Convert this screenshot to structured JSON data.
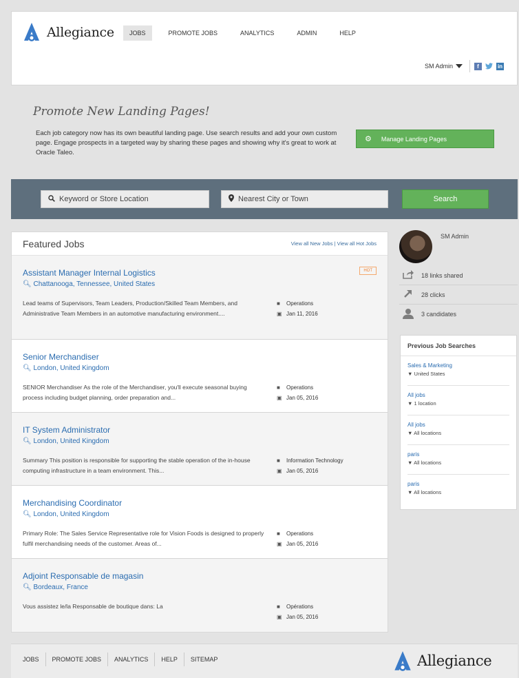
{
  "header": {
    "brand": "Allegiance",
    "nav": [
      {
        "label": "JOBS",
        "active": true
      },
      {
        "label": "PROMOTE JOBS",
        "active": false
      },
      {
        "label": "ANALYTICS",
        "active": false
      },
      {
        "label": "ADMIN",
        "active": false
      },
      {
        "label": "HELP",
        "active": false
      }
    ],
    "user": "SM Admin",
    "social": {
      "facebook": "f",
      "twitter": "t",
      "linkedin": "in"
    }
  },
  "promo": {
    "title": "Promote New Landing Pages!",
    "text": "Each job category now has its own beautiful landing page. Use search results and add your own custom page. Engage prospects in a targeted way by sharing these pages and showing why it's great to work at Oracle Taleo.",
    "button": "Manage Landing Pages"
  },
  "search": {
    "keyword_placeholder": "Keyword or Store Location",
    "location_placeholder": "Nearest City or Town",
    "button": "Search"
  },
  "featured": {
    "title": "Featured Jobs",
    "link_new": "View all New Jobs",
    "link_sep": "|",
    "link_hot": "View all Hot Jobs",
    "jobs": [
      {
        "title": "Assistant Manager Internal Logistics",
        "location": "Chattanooga, Tennessee, United States",
        "description": "Lead teams of Supervisors, Team Leaders, Production/Skilled Team Members, and Administrative Team Members in an automotive manufacturing environment....",
        "category": "Operations",
        "date": "Jan 11, 2016",
        "badge": "HOT"
      },
      {
        "title": "Senior Merchandiser",
        "location": "London, United Kingdom",
        "description": "SENIOR Merchandiser As the role of the Merchandiser, you'll execute seasonal buying process including budget planning, order preparation and...",
        "category": "Operations",
        "date": "Jan 05, 2016",
        "badge": ""
      },
      {
        "title": "IT System Administrator",
        "location": "London, United Kingdom",
        "description": "Summary This position is responsible for supporting the stable operation of the in-house computing infrastructure in a team environment. This...",
        "category": "Information Technology",
        "date": "Jan 05, 2016",
        "badge": ""
      },
      {
        "title": "Merchandising Coordinator",
        "location": "London, United Kingdom",
        "description": "Primary Role: The Sales Service Representative role for Vision Foods is designed to properly fulfil merchandising needs of the customer. Areas of...",
        "category": "Operations",
        "date": "Jan 05, 2016",
        "badge": ""
      },
      {
        "title": "Adjoint Responsable de magasin",
        "location": "Bordeaux, France",
        "description": "Vous assistez le/la Responsable de boutique dans: La",
        "category": "Opérations",
        "date": "Jan 05, 2016",
        "badge": ""
      }
    ]
  },
  "profile": {
    "name": "SM Admin",
    "stats": [
      {
        "icon": "share-icon",
        "label": "18 links shared"
      },
      {
        "icon": "click-arrow-icon",
        "label": "28 clicks"
      },
      {
        "icon": "person-icon",
        "label": "3 candidates"
      }
    ]
  },
  "previous_searches": {
    "title": "Previous Job Searches",
    "items": [
      {
        "query": "Sales & Marketing",
        "location": "United States"
      },
      {
        "query": "All jobs",
        "location": "1 location"
      },
      {
        "query": "All jobs",
        "location": "All locations"
      },
      {
        "query": "paris",
        "location": "All locations"
      },
      {
        "query": "paris",
        "location": "All locations"
      }
    ]
  },
  "footer": {
    "links": [
      "JOBS",
      "PROMOTE JOBS",
      "ANALYTICS",
      "HELP",
      "SITEMAP"
    ],
    "brand": "Allegiance"
  },
  "colors": {
    "accent_green": "#63b25a",
    "link_blue": "#2a6cb0",
    "search_bar": "#5e6f7d",
    "hot_orange": "#f07f2b"
  }
}
